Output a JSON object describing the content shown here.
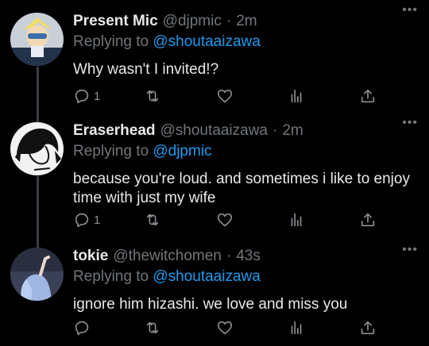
{
  "tweets": [
    {
      "name": "Present Mic",
      "handle": "@djpmic",
      "dot": "·",
      "time": "2m",
      "replying_prefix": "Replying to",
      "replying_to": "@shoutaaizawa",
      "text": "Why wasn't I invited!?",
      "reply_count": "1",
      "retweet_count": "",
      "like_count": "",
      "more": "•••"
    },
    {
      "name": "Eraserhead",
      "handle": "@shoutaaizawa",
      "dot": "·",
      "time": "2m",
      "replying_prefix": "Replying to",
      "replying_to": "@djpmic",
      "text": "because you're loud. and sometimes i like to enjoy time with just my wife",
      "reply_count": "1",
      "retweet_count": "",
      "like_count": "",
      "more": "•••"
    },
    {
      "name": "tokie",
      "handle": "@thewitchomen",
      "dot": "·",
      "time": "43s",
      "replying_prefix": "Replying to",
      "replying_to": "@shoutaaizawa",
      "text": "ignore him hizashi. we love and miss you",
      "reply_count": "",
      "retweet_count": "",
      "like_count": "",
      "more": "•••"
    }
  ],
  "icons": {
    "reply": "reply-icon",
    "retweet": "retweet-icon",
    "like": "heart-icon",
    "views": "analytics-icon",
    "share": "share-icon"
  },
  "colors": {
    "background": "#000000",
    "text": "#e7e9ea",
    "muted": "#71767b",
    "accent": "#1d9bf0",
    "thread_line": "#3b3f44"
  }
}
